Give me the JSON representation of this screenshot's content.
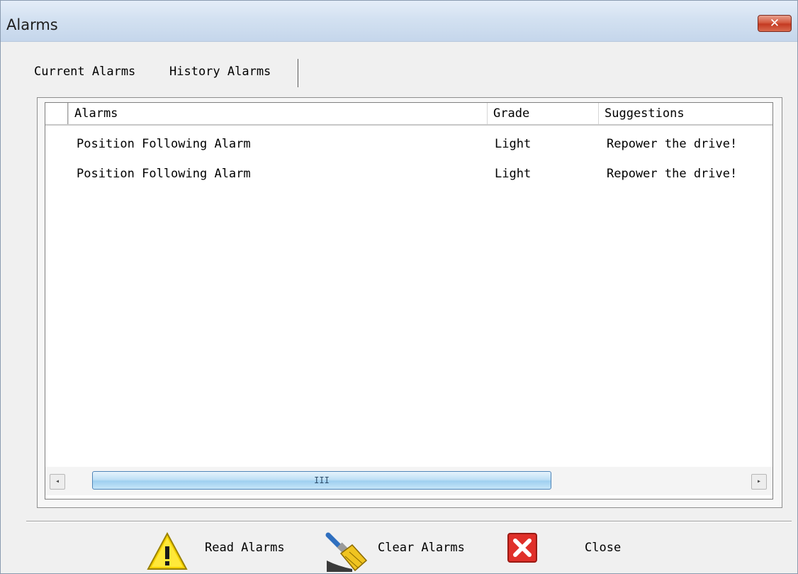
{
  "window": {
    "title": "Alarms",
    "close_glyph": "✕"
  },
  "tabs": [
    {
      "label": "Current Alarms",
      "active": false
    },
    {
      "label": "History Alarms",
      "active": true
    }
  ],
  "table": {
    "columns": [
      "Alarms",
      "Grade",
      "Suggestions"
    ],
    "rows": [
      {
        "alarm": "Position Following Alarm",
        "grade": "Light",
        "suggestion": "Repower the drive!"
      },
      {
        "alarm": "Position Following Alarm",
        "grade": "Light",
        "suggestion": "Repower the drive!"
      }
    ],
    "scrollbar": {
      "thumb_grip": "III",
      "left_arrow": "◂",
      "right_arrow": "▸"
    }
  },
  "buttons": {
    "read": {
      "label": "Read Alarms",
      "icon": "warning-icon"
    },
    "clear": {
      "label": "Clear Alarms",
      "icon": "brush-icon"
    },
    "close": {
      "label": "Close",
      "icon": "red-x-icon"
    }
  },
  "colors": {
    "titlebar": "#d3e1f1",
    "close_red": "#c43a22",
    "scroll_thumb": "#9fd0f0",
    "warning_yellow": "#f5d100"
  }
}
